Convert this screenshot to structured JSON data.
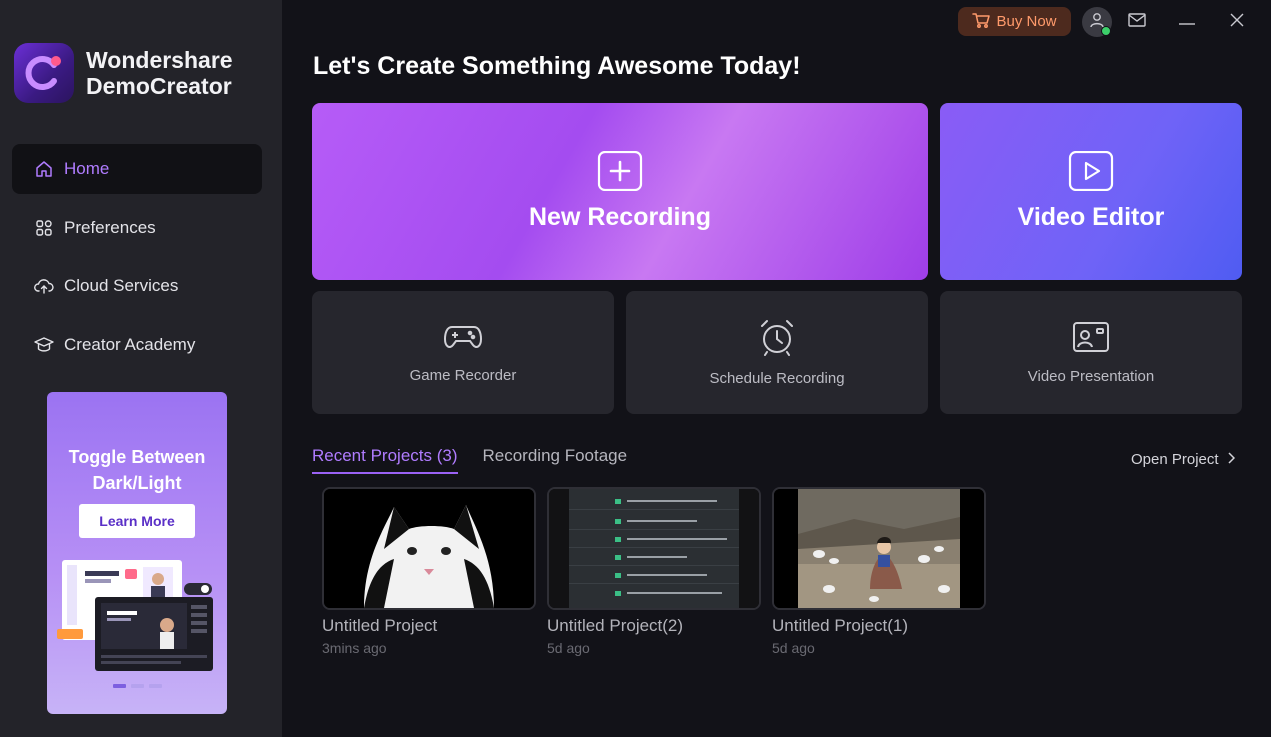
{
  "app": {
    "brand_line1": "Wondershare",
    "brand_line2": "DemoCreator"
  },
  "topbar": {
    "buy_label": "Buy Now"
  },
  "sidebar": {
    "items": [
      {
        "label": "Home",
        "icon": "home-icon",
        "active": true
      },
      {
        "label": "Preferences",
        "icon": "grid-icon",
        "active": false
      },
      {
        "label": "Cloud Services",
        "icon": "cloud-upload-icon",
        "active": false
      },
      {
        "label": "Creator Academy",
        "icon": "graduation-cap-icon",
        "active": false
      }
    ]
  },
  "promo": {
    "title_line1": "Toggle Between",
    "title_line2": "Dark/Light",
    "button_label": "Learn More",
    "slides": 3,
    "active_slide": 1
  },
  "main": {
    "headline": "Let's Create Something Awesome Today!",
    "new_recording": "New Recording",
    "video_editor": "Video Editor",
    "tools": [
      {
        "label": "Game Recorder",
        "icon": "gamepad-icon"
      },
      {
        "label": "Schedule Recording",
        "icon": "alarm-clock-icon"
      },
      {
        "label": "Video Presentation",
        "icon": "presentation-icon"
      }
    ],
    "tabs": [
      {
        "label": "Recent Projects (3)",
        "active": true
      },
      {
        "label": "Recording Footage",
        "active": false
      }
    ],
    "open_project": "Open Project",
    "projects": [
      {
        "name": "Untitled Project",
        "time": "3mins ago"
      },
      {
        "name": "Untitled Project(2)",
        "time": "5d ago"
      },
      {
        "name": "Untitled Project(1)",
        "time": "5d ago"
      }
    ]
  },
  "colors": {
    "accent": "#b07cff",
    "sidebar_bg": "#232329",
    "main_bg": "#121218",
    "buy_text": "#ff9a6b"
  }
}
